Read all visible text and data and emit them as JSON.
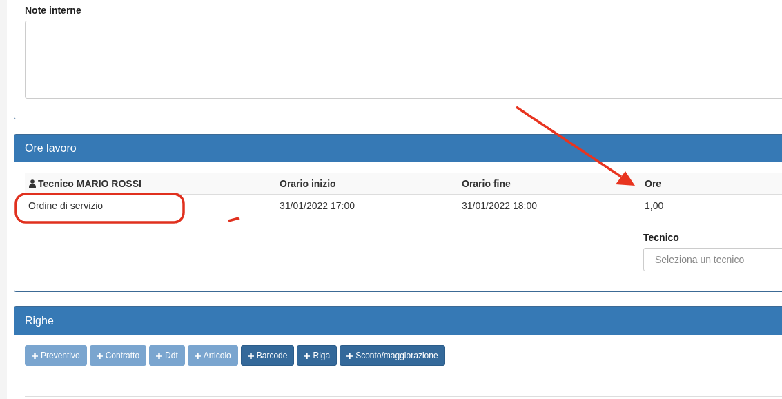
{
  "notes_panel": {
    "label": "Note interne"
  },
  "work_hours": {
    "title": "Ore lavoro",
    "columns": [
      "Tecnico MARIO ROSSI",
      "Orario inizio",
      "Orario fine",
      "Ore"
    ],
    "rows": [
      [
        "Ordine di servizio",
        "31/01/2022 17:00",
        "31/01/2022 18:00",
        "1,00"
      ]
    ],
    "technician_field": {
      "label": "Tecnico",
      "placeholder": "Seleziona un tecnico"
    }
  },
  "lines": {
    "title": "Righe",
    "buttons": [
      {
        "label": "Preventivo",
        "disabled": true
      },
      {
        "label": "Contratto",
        "disabled": true
      },
      {
        "label": "Ddt",
        "disabled": true
      },
      {
        "label": "Articolo",
        "disabled": true
      },
      {
        "label": "Barcode",
        "disabled": false
      },
      {
        "label": "Riga",
        "disabled": false
      },
      {
        "label": "Sconto/maggiorazione",
        "disabled": false
      }
    ]
  }
}
